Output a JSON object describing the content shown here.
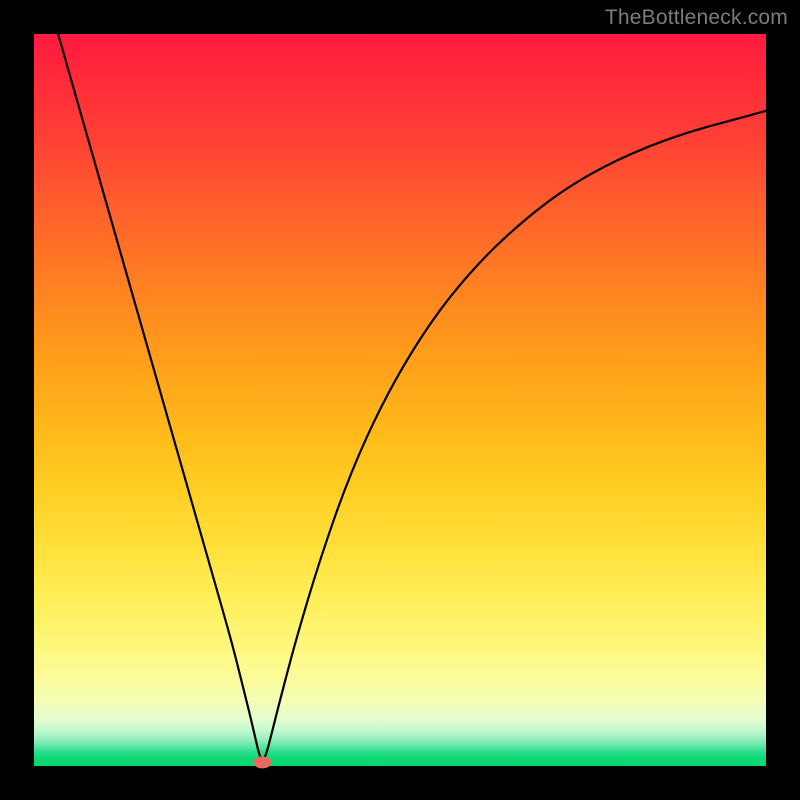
{
  "watermark": "TheBottleneck.com",
  "chart_data": {
    "type": "line",
    "title": "",
    "xlabel": "",
    "ylabel": "",
    "xlim": [
      0,
      1
    ],
    "ylim": [
      0,
      1
    ],
    "grid": false,
    "legend": false,
    "series": [
      {
        "name": "bottleneck-curve",
        "stroke": "#000000",
        "stroke_width": 2.2,
        "x": [
          0.033,
          0.06,
          0.09,
          0.12,
          0.15,
          0.18,
          0.21,
          0.24,
          0.27,
          0.285,
          0.295,
          0.302,
          0.307,
          0.312,
          0.318,
          0.326,
          0.34,
          0.36,
          0.39,
          0.43,
          0.48,
          0.54,
          0.6,
          0.66,
          0.72,
          0.78,
          0.84,
          0.9,
          0.96,
          1.0
        ],
        "y": [
          1.0,
          0.905,
          0.8,
          0.695,
          0.59,
          0.485,
          0.38,
          0.275,
          0.17,
          0.11,
          0.07,
          0.04,
          0.018,
          0.005,
          0.018,
          0.05,
          0.105,
          0.18,
          0.28,
          0.395,
          0.505,
          0.605,
          0.68,
          0.738,
          0.785,
          0.82,
          0.847,
          0.868,
          0.884,
          0.895
        ]
      }
    ],
    "marker": {
      "name": "optimal-point",
      "x": 0.312,
      "y": 0.005,
      "color": "#e9695e",
      "rx": 9,
      "ry": 6
    },
    "background_bands_note": "continuous vertical gradient red→green; encoded via CSS, not discrete data"
  }
}
